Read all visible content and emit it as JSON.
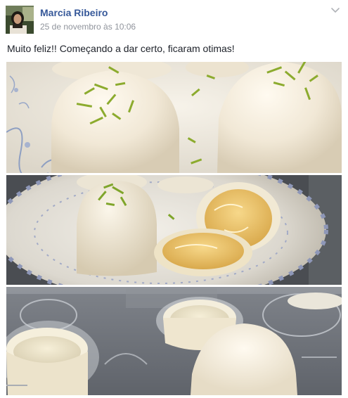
{
  "post": {
    "author_name": "Marcia Ribeiro",
    "timestamp": "25 de novembro às 10:06",
    "text": "Muito feliz!! Começando a dar certo, ficaram otimas!",
    "photos": [
      {
        "alt": "Doces brancos com raspas de limão"
      },
      {
        "alt": "Doce cortado com recheio de limão"
      },
      {
        "alt": "Casquinhas de chocolate branco na forma"
      }
    ]
  },
  "icons": {
    "menu": "chevron-down-icon",
    "avatar": "profile-photo"
  },
  "colors": {
    "author_link": "#365899",
    "timestamp": "#90949c",
    "text": "#1d2129"
  }
}
